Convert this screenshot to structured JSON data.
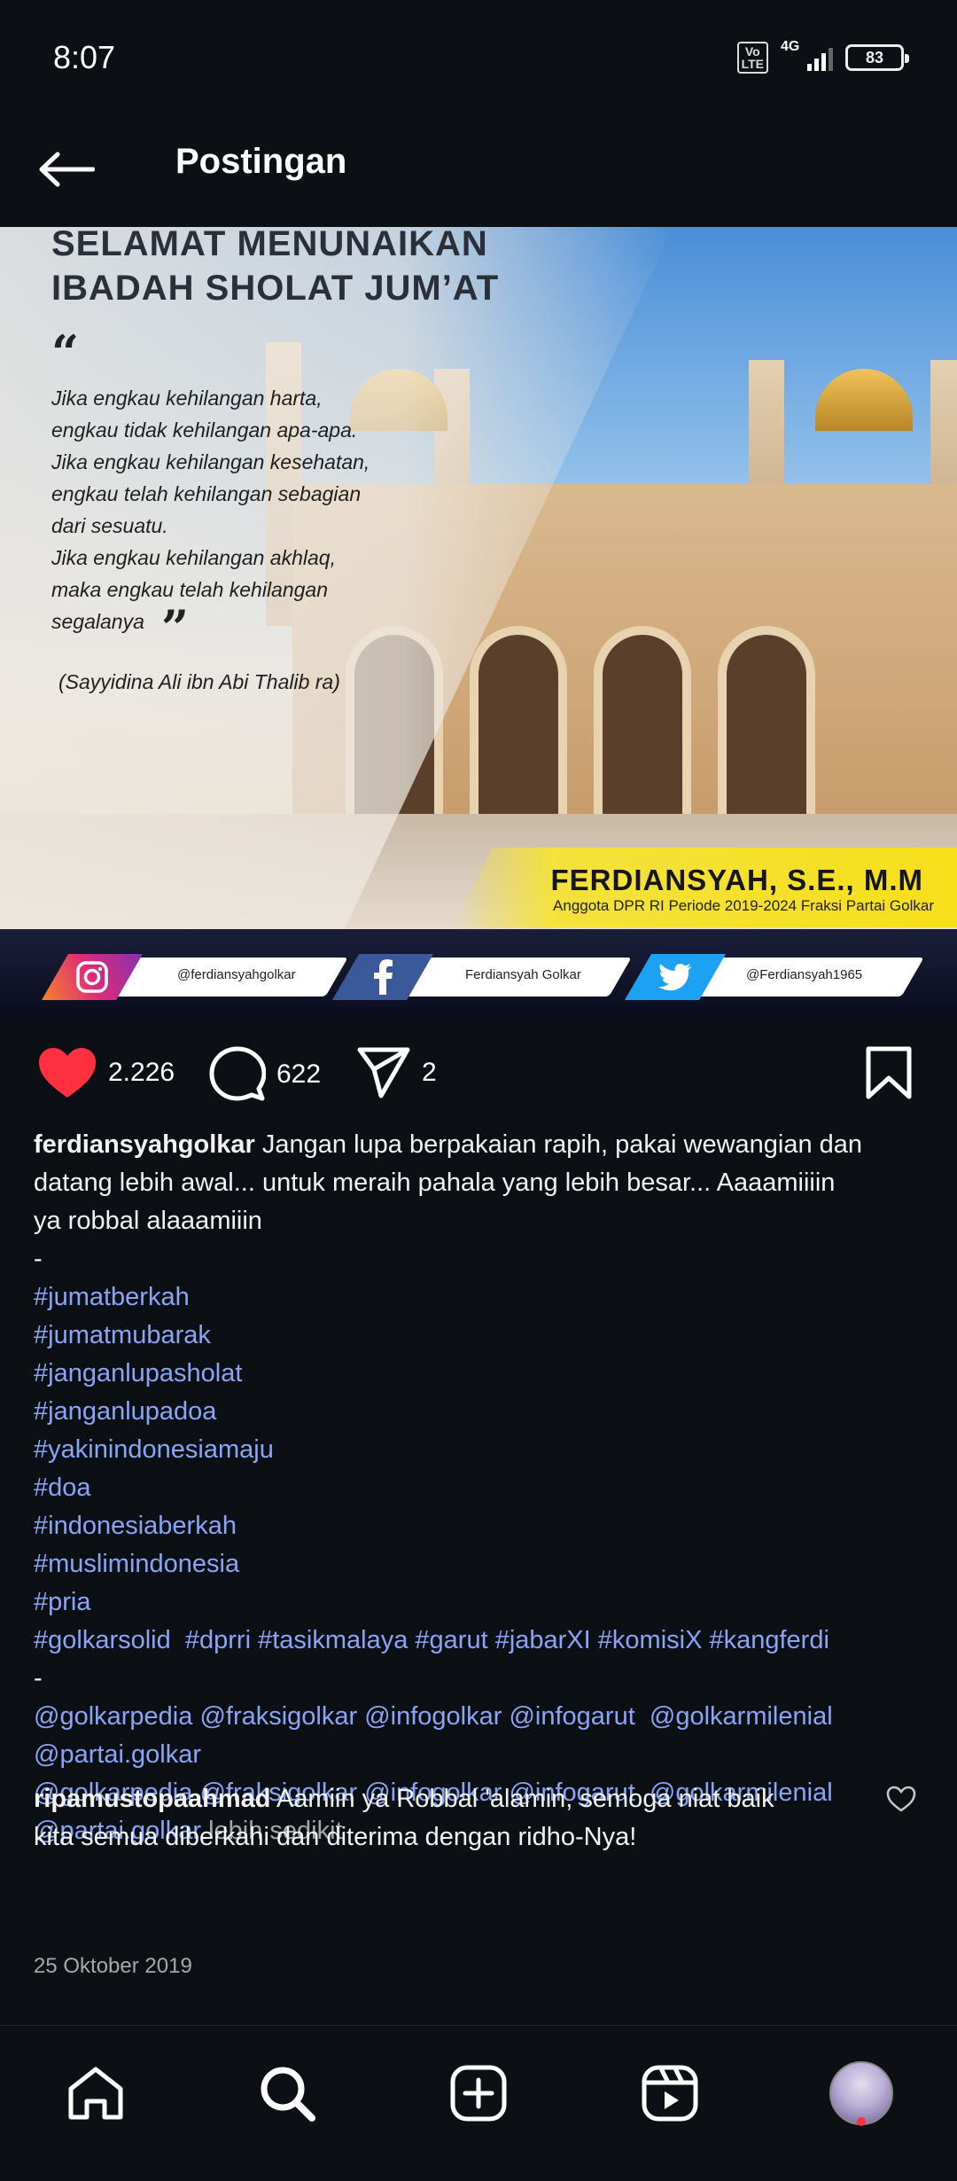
{
  "status_bar": {
    "time": "8:07",
    "volte": "Vo\nLTE",
    "network": "4G",
    "battery": "83"
  },
  "header": {
    "title": "Postingan"
  },
  "post_image": {
    "headline_line1": "SELAMAT MENUNAIKAN",
    "headline_line2": "IBADAH SHOLAT JUM’AT",
    "quote": "Jika engkau kehilangan harta,\nengkau tidak kehilangan apa-apa.\nJika engkau kehilangan kesehatan,\n engkau telah kehilangan sebagian\ndari sesuatu.\nJika engkau kehilangan akhlaq,\nmaka engkau telah kehilangan\nsegalanya",
    "quote_source": "(Sayyidina Ali ibn Abi Thalib ra)",
    "name": "FERDIANSYAH, S.E., M.M",
    "name_subtitle": "Anggota DPR RI Periode 2019-2024 Fraksi Partai Golkar",
    "social": [
      {
        "icon": "instagram-icon",
        "label": "@ferdiansyahgolkar",
        "color": "#d6249f"
      },
      {
        "icon": "facebook-icon",
        "label": "Ferdiansyah Golkar",
        "color": "#3b5998"
      },
      {
        "icon": "twitter-icon",
        "label": "@Ferdiansyah1965",
        "color": "#1da1f2"
      }
    ]
  },
  "actions": {
    "likes": "2.226",
    "comments": "622",
    "shares": "2"
  },
  "caption": {
    "username": "ferdiansyahgolkar",
    "text_line1": " Jangan lupa berpakaian rapih, pakai wewangian dan",
    "text_line2": "datang lebih awal... untuk meraih pahala yang lebih besar... Aaaamiiiin",
    "text_line3": "ya robbal alaaamiiin",
    "dash": "-",
    "hashtags": [
      "#jumatberkah",
      "#jumatmubarak",
      "#janganlupasholat",
      "#janganlupadoa",
      "#yakinindonesiamaju",
      "#doa",
      "#indonesiaberkah",
      "#muslimindonesia",
      "#pria"
    ],
    "hashtag_row": [
      "#golkarsolid ",
      " #dprri",
      " #tasikmalaya",
      " #garut",
      " #jabarXI",
      " #komisiX",
      " #kangferdi"
    ],
    "mentions_row1": [
      "@golkarpedia",
      " @fraksigolkar",
      " @infogolkar",
      " @infogarut",
      "  @golkarmilenial"
    ],
    "mentions_row2": [
      "@partai.golkar"
    ],
    "mentions_row3": [
      "@golkarpedia",
      " @fraksigolkar",
      " @infogolkar",
      " @infogarut",
      "  @golkarmilenial"
    ],
    "mentions_row4": [
      "@partai.golkar"
    ],
    "more": " lebih sedikit"
  },
  "comment": {
    "username": "ripamustopaahmad",
    "text_line1": " Aamiin ya Robbal 'alamin, semoga niat baik",
    "text_line2": "kita semua diberkahi dan diterima dengan ridho-Nya!"
  },
  "date": "25 Oktober 2019",
  "colors": {
    "background": "#0c1014",
    "link": "#8aa5f5",
    "like": "#ff3040"
  }
}
